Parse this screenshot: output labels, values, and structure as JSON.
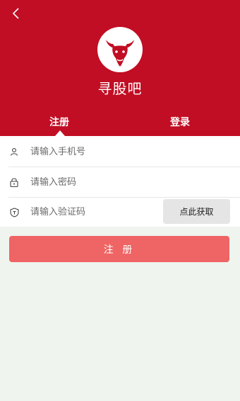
{
  "header": {
    "app_name": "寻股吧"
  },
  "tabs": [
    {
      "label": "注册",
      "active": true
    },
    {
      "label": "登录",
      "active": false
    }
  ],
  "form": {
    "phone_placeholder": "请输入手机号",
    "password_placeholder": "请输入密码",
    "code_placeholder": "请输入验证码",
    "get_code_label": "点此获取"
  },
  "submit_label": "注 册",
  "colors": {
    "brand_red": "#c10e24",
    "button_red": "#ef6464",
    "page_background": "#eff4ee"
  },
  "icons": [
    "back-arrow-icon",
    "bull-logo-icon",
    "user-icon",
    "lock-icon",
    "shield-icon"
  ]
}
